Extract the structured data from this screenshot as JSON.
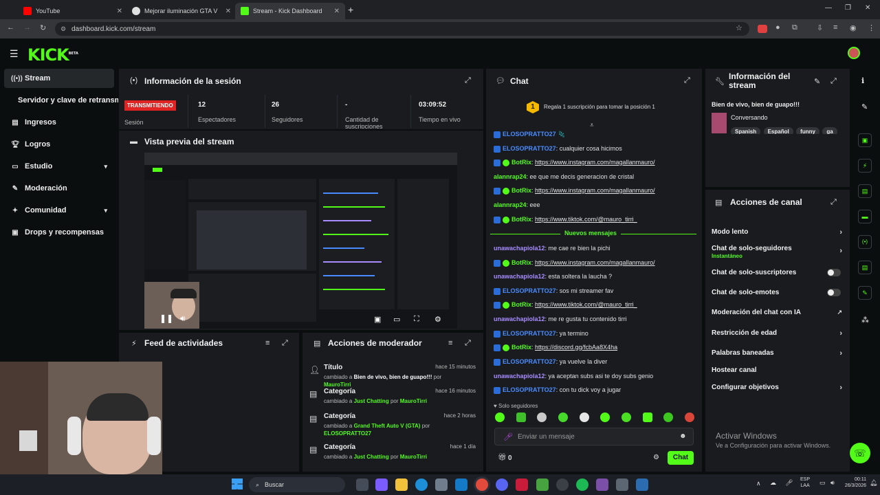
{
  "browser": {
    "tabs": [
      {
        "label": "YouTube",
        "color": "#ff0000"
      },
      {
        "label": "Mejorar iluminación GTA V",
        "color": "#e0e0e0"
      },
      {
        "label": "Stream - Kick Dashboard",
        "color": "#53fc18"
      }
    ],
    "url": "dashboard.kick.com/stream"
  },
  "brand": {
    "logo": "KICK",
    "beta": "BETA",
    "accent": "#53fc18"
  },
  "sidebar": {
    "items": [
      {
        "label": "Stream",
        "icon": "broadcast-icon"
      },
      {
        "label": "Servidor y clave de retransmisión"
      },
      {
        "label": "Ingresos",
        "icon": "chart-icon"
      },
      {
        "label": "Logros",
        "icon": "trophy-icon"
      },
      {
        "label": "Estudio",
        "icon": "studio-icon"
      },
      {
        "label": "Moderación",
        "icon": "wrench-icon"
      },
      {
        "label": "Comunidad",
        "icon": "community-icon"
      },
      {
        "label": "Drops y recompensas",
        "icon": "drops-icon"
      }
    ]
  },
  "session": {
    "title": "Información de la sesión",
    "status": "TRANSMITIENDO",
    "status_label": "Sesión",
    "stats": [
      {
        "value": "12",
        "label": "Espectadores"
      },
      {
        "value": "26",
        "label": "Seguidores"
      },
      {
        "value": "-",
        "label": "Cantidad de suscripciones"
      },
      {
        "value": "03:09:52",
        "label": "Tiempo en vivo"
      }
    ]
  },
  "preview": {
    "title": "Vista previa del stream"
  },
  "feed": {
    "title": "Feed de actividades"
  },
  "mod_actions": {
    "title": "Acciones de moderador",
    "items": [
      {
        "type": "Título",
        "ago": "hace 15 minutos",
        "prefix": "cambiado a",
        "value": "Bien de vivo, bien de guapo!!!",
        "by": "por",
        "user": "MauroTirri"
      },
      {
        "type": "Categoría",
        "ago": "hace 16 minutos",
        "prefix": "cambiado a",
        "value": "Just Chatting",
        "by": "por",
        "user": "MauroTirri"
      },
      {
        "type": "Categoría",
        "ago": "hace 2 horas",
        "prefix": "cambiado a",
        "value": "Grand Theft Auto V (GTA)",
        "by": "por",
        "user": "ELOSOPRATTO27"
      },
      {
        "type": "Categoría",
        "ago": "hace 1 día",
        "prefix": "cambiado a",
        "value": "Just Chatting",
        "by": "por",
        "user": "MauroTirri"
      }
    ]
  },
  "chat": {
    "title": "Chat",
    "gift_prompt": "Regala 1 suscripción para tomar la posición 1",
    "new_messages": "Nuevos mensajes",
    "messages": [
      {
        "user": "ELOSOPRATTO27",
        "color": "#4a8cff",
        "text": "",
        "link": false
      },
      {
        "user": "ELOSOPRATTO27",
        "color": "#4a8cff",
        "text": "cualquier cosa hicimos",
        "link": false
      },
      {
        "user": "BotRix",
        "color": "#53fc18",
        "text": "https://www.instagram.com/magallanmauro/",
        "link": true
      },
      {
        "user": "alannrap24",
        "color": "#53fc18",
        "text": "ee que me decis generacion de cristal",
        "link": false
      },
      {
        "user": "BotRix",
        "color": "#53fc18",
        "text": "https://www.instagram.com/magallanmauro/",
        "link": true
      },
      {
        "user": "alannrap24",
        "color": "#53fc18",
        "text": "eee",
        "link": false
      },
      {
        "user": "BotRix",
        "color": "#53fc18",
        "text": "https://www.tiktok.com/@mauro_tirri_",
        "link": true
      },
      {
        "user": "unawachapiola12",
        "color": "#a88cff",
        "text": "me cae re bien la pichi",
        "link": false
      },
      {
        "user": "BotRix",
        "color": "#53fc18",
        "text": "https://www.instagram.com/magallanmauro/",
        "link": true
      },
      {
        "user": "unawachapiola12",
        "color": "#a88cff",
        "text": "esta soltera la laucha ?",
        "link": false
      },
      {
        "user": "ELOSOPRATTO27",
        "color": "#4a8cff",
        "text": "sos mi streamer fav",
        "link": false
      },
      {
        "user": "BotRix",
        "color": "#53fc18",
        "text": "https://www.tiktok.com/@mauro_tirri_",
        "link": true
      },
      {
        "user": "unawachapiola12",
        "color": "#a88cff",
        "text": "me re gusta tu contenido tirri",
        "link": false
      },
      {
        "user": "ELOSOPRATTO27",
        "color": "#4a8cff",
        "text": "ya termino",
        "link": false
      },
      {
        "user": "BotRix",
        "color": "#53fc18",
        "text": "https://discord.gg/fcbAa8X4ha",
        "link": true
      },
      {
        "user": "ELOSOPRATTO27",
        "color": "#4a8cff",
        "text": "ya vuelve la diver",
        "link": false
      },
      {
        "user": "unawachapiola12",
        "color": "#a88cff",
        "text": "ya aceptan subs asi te doy subs genio",
        "link": false
      },
      {
        "user": "ELOSOPRATTO27",
        "color": "#4a8cff",
        "text": "con tu dick voy a jugar",
        "link": false
      }
    ],
    "followers_only": "Solo seguidores",
    "input_placeholder": "Enviar un mensaje",
    "points": "0",
    "send_label": "Chat"
  },
  "stream_info": {
    "title": "Información del stream",
    "stream_title": "Bien de vivo, bien de guapo!!!",
    "category": "Conversando",
    "tags": [
      "Spanish",
      "Español",
      "funny",
      "ga"
    ]
  },
  "channel_actions": {
    "title": "Acciones de canal",
    "items": [
      {
        "label": "Modo lento",
        "sub": "",
        "control": "chevron"
      },
      {
        "label": "Chat de solo-seguidores",
        "sub": "Instantáneo",
        "control": "chevron"
      },
      {
        "label": "Chat de solo-suscriptores",
        "sub": "",
        "control": "toggle"
      },
      {
        "label": "Chat de solo-emotes",
        "sub": "",
        "control": "toggle"
      },
      {
        "label": "Moderación del chat con IA",
        "sub": "",
        "control": "external"
      },
      {
        "label": "Restricción de edad",
        "sub": "",
        "control": "chevron"
      },
      {
        "label": "Palabras baneadas",
        "sub": "",
        "control": "chevron"
      },
      {
        "label": "Hostear canal",
        "sub": "",
        "control": "none"
      },
      {
        "label": "Configurar objetivos",
        "sub": "",
        "control": "chevron"
      }
    ]
  },
  "windows": {
    "activate_title": "Activar Windows",
    "activate_sub": "Ve a Configuración para activar Windows.",
    "search": "Buscar",
    "lang": "ESP",
    "lang2": "LAA",
    "time": "00:11",
    "date": "26/3/2026"
  }
}
